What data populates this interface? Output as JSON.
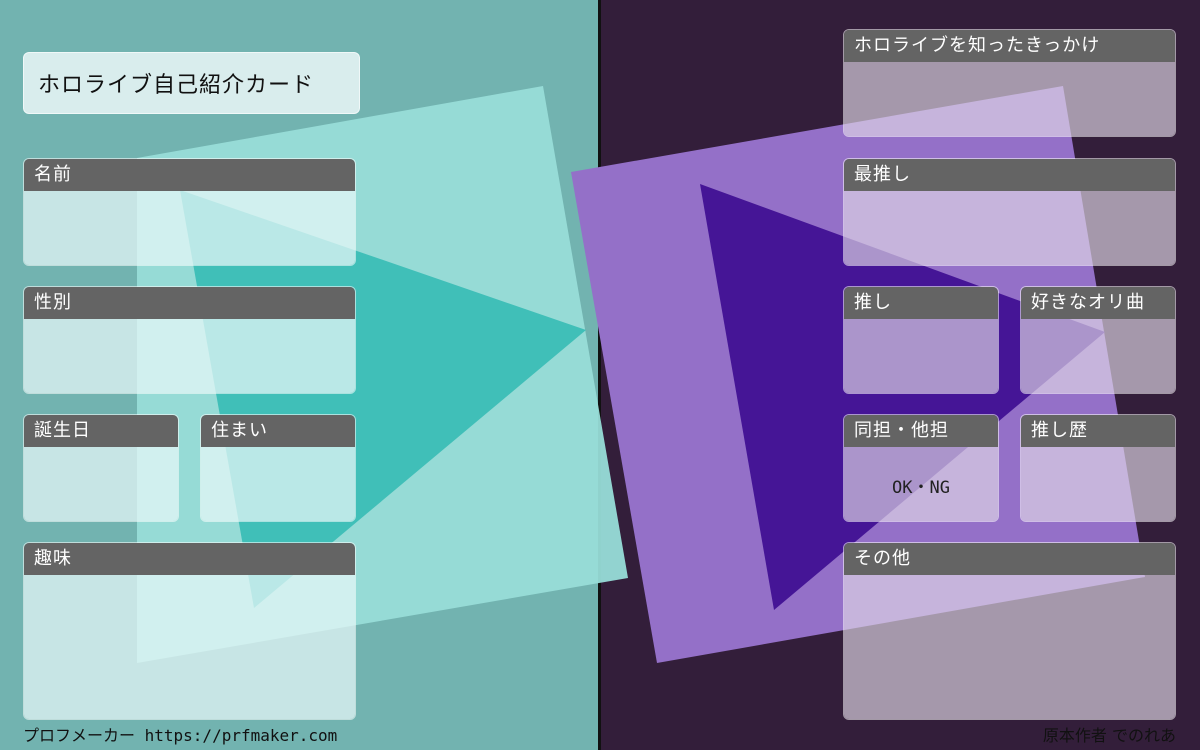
{
  "card": {
    "title": "ホロライブ自己紹介カード"
  },
  "left_fields": {
    "name": "名前",
    "gender": "性別",
    "birthday": "誕生日",
    "residence": "住まい",
    "hobby": "趣味"
  },
  "right_fields": {
    "how_found": "ホロライブを知ったきっかけ",
    "top_oshi": "最推し",
    "oshi": "推し",
    "favorite_song": "好きなオリ曲",
    "same_other": "同担・他担",
    "same_other_value": "OK・NG",
    "oshi_history": "推し歴",
    "other": "その他"
  },
  "footer": {
    "left": "プロフメーカー https://prfmaker.com",
    "right": "原本作者 でのれあ"
  },
  "colors": {
    "left_background": "#72b3b0",
    "right_background": "#331e3a",
    "label_bar": "#646464"
  }
}
